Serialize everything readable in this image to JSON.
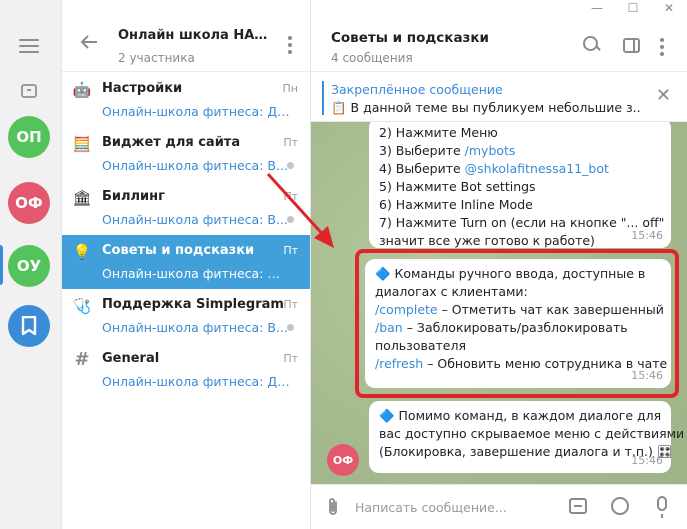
{
  "rail": {
    "avatars": [
      {
        "initials": "ОП",
        "color": "#55c35b"
      },
      {
        "initials": "ОФ",
        "color": "#e3586e"
      },
      {
        "initials": "ОУ",
        "color": "#55c35b"
      },
      {
        "initials": "",
        "color": "#3a8bd8"
      }
    ]
  },
  "group": {
    "title": "Онлайн школа НАСТ...",
    "subtitle": "2 участника"
  },
  "topics": [
    {
      "icon": "🤖",
      "name": "Настройки",
      "time": "Пн",
      "preview": "Онлайн-школа фитнеса: Добр..."
    },
    {
      "icon": "🧮",
      "name": "Виджет для сайта",
      "time": "Пт",
      "preview": "Онлайн-школа фитнеса: В..."
    },
    {
      "icon": "🏛",
      "name": "Биллинг",
      "time": "Пт",
      "preview": "Онлайн-школа фитнеса: В..."
    },
    {
      "icon": "💡",
      "name": "Советы и подсказки",
      "time": "Пт",
      "preview": "Онлайн-школа фитнеса: 🔷 П..."
    },
    {
      "icon": "🩺",
      "name": "Поддержка Simplegram",
      "time": "Пт",
      "preview": "Онлайн-школа фитнеса: В..."
    },
    {
      "icon": "#",
      "name": "General",
      "time": "Пт",
      "preview": "Онлайн-школа фитнеса: Для д..."
    }
  ],
  "chat": {
    "title": "Советы и подсказки",
    "subtitle": "4 сообщения",
    "pinned_title": "Закреплённое сообщение",
    "pinned_text": "📋 В данной теме вы публикуем небольшие з...",
    "messages": [
      {
        "lines": [
          "2) Нажмите Меню",
          "3) Выберите ",
          "4) Выберите ",
          "5) Нажмите Bot settings",
          "6) Нажмите Inline Mode",
          "7) Нажмите Turn on (если на кнопке \"... off\"",
          "значит все уже готово к работе)"
        ],
        "cmd1": "/mybots",
        "cmd2": "@shkolafitnessa11_bot",
        "time": "15:46"
      },
      {
        "line1": "🔷 Команды ручного ввода, доступные в",
        "line2": "диалогах с клиентами:",
        "cmd_complete": "/complete",
        "text_complete": " – Отметить чат как завершенный",
        "cmd_ban": "/ban",
        "text_ban": " – Заблокировать/разблокировать",
        "line_user": "пользователя",
        "cmd_refresh": "/refresh",
        "text_refresh": " – Обновить меню сотрудника в чате",
        "time": "15:46"
      },
      {
        "line1": "🔷 Помимо команд, в каждом диалоге для",
        "line2": "вас доступно скрываемое меню с действиями",
        "line3": "(Блокировка, завершение диалога и т.п.) 🎛",
        "time": "15:46",
        "avatar": "ОФ"
      }
    ],
    "composer_placeholder": "Написать сообщение..."
  },
  "colors": {
    "accent": "#419fd9",
    "highlight": "#e0242b"
  }
}
